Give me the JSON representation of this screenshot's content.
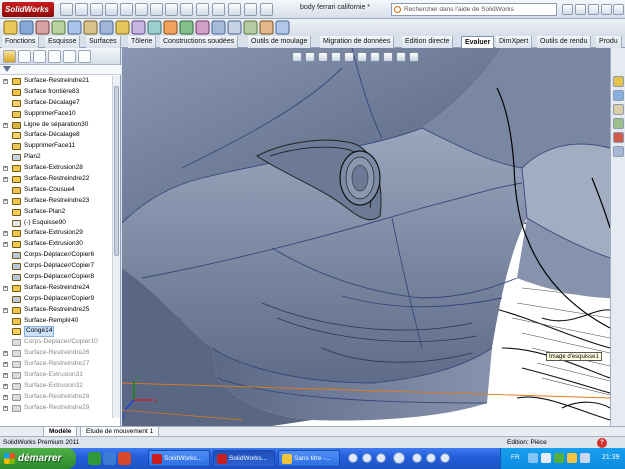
{
  "app": {
    "logo_text": "SolidWorks",
    "document_title": "body ferrari californie *",
    "search_placeholder": "Rechercher dans l'aide de SolidWorks"
  },
  "ribbon_tabs": [
    {
      "label": "Fonctions"
    },
    {
      "label": "Esquisse"
    },
    {
      "label": "Surfaces"
    },
    {
      "label": "Tôlerie"
    },
    {
      "label": "Constructions soudées"
    },
    {
      "label": "Outils de moulage"
    },
    {
      "label": "Migration de données"
    },
    {
      "label": "Edition directe"
    },
    {
      "label": "Evaluer"
    },
    {
      "label": "DimXpert"
    },
    {
      "label": "Outils de rendu"
    },
    {
      "label": "Produ"
    }
  ],
  "active_tab": "Evaluer",
  "feature_tree": [
    {
      "label": "Surface-Restreindre21",
      "icon": "surface-trim-icon",
      "expand": true,
      "state": "normal"
    },
    {
      "label": "Surface frontière83",
      "icon": "boundary-surface-icon",
      "expand": false,
      "state": "normal"
    },
    {
      "label": "Surface-Décalage7",
      "icon": "offset-surface-icon",
      "expand": false,
      "state": "normal"
    },
    {
      "label": "SupprimerFace10",
      "icon": "delete-face-icon",
      "expand": false,
      "state": "normal"
    },
    {
      "label": "Ligne de séparation30",
      "icon": "split-line-icon",
      "expand": true,
      "state": "normal"
    },
    {
      "label": "Surface-Décalage8",
      "icon": "offset-surface-icon",
      "expand": false,
      "state": "normal"
    },
    {
      "label": "SupprimerFace11",
      "icon": "delete-face-icon",
      "expand": false,
      "state": "normal"
    },
    {
      "label": "Plan2",
      "icon": "plane-icon",
      "expand": false,
      "state": "normal"
    },
    {
      "label": "Surface-Extrusion28",
      "icon": "extrude-surface-icon",
      "expand": true,
      "state": "normal"
    },
    {
      "label": "Surface-Restreindre22",
      "icon": "surface-trim-icon",
      "expand": true,
      "state": "normal"
    },
    {
      "label": "Surface-Cousue4",
      "icon": "knit-surface-icon",
      "expand": false,
      "state": "normal"
    },
    {
      "label": "Surface-Restreindre23",
      "icon": "surface-trim-icon",
      "expand": true,
      "state": "normal"
    },
    {
      "label": "Surface-Plan2",
      "icon": "planar-surface-icon",
      "expand": false,
      "state": "normal"
    },
    {
      "label": "(-) Esquisse90",
      "icon": "sketch-icon",
      "expand": false,
      "state": "normal"
    },
    {
      "label": "Surface-Extrusion29",
      "icon": "extrude-surface-icon",
      "expand": true,
      "state": "normal"
    },
    {
      "label": "Surface-Extrusion30",
      "icon": "extrude-surface-icon",
      "expand": true,
      "state": "normal"
    },
    {
      "label": "Corps-Déplacer/Copier6",
      "icon": "move-copy-body-icon",
      "expand": false,
      "state": "normal"
    },
    {
      "label": "Corps-Déplacer/Copier7",
      "icon": "move-copy-body-icon",
      "expand": false,
      "state": "normal"
    },
    {
      "label": "Corps-Déplacer/Copier8",
      "icon": "move-copy-body-icon",
      "expand": false,
      "state": "normal"
    },
    {
      "label": "Surface-Restreindre24",
      "icon": "surface-trim-icon",
      "expand": true,
      "state": "normal"
    },
    {
      "label": "Corps-Déplacer/Copier9",
      "icon": "move-copy-body-icon",
      "expand": false,
      "state": "normal"
    },
    {
      "label": "Surface-Restreindre25",
      "icon": "surface-trim-icon",
      "expand": true,
      "state": "normal"
    },
    {
      "label": "Surface-Remplir40",
      "icon": "fill-surface-icon",
      "expand": false,
      "state": "normal"
    },
    {
      "label": "Congé14",
      "icon": "fillet-icon",
      "expand": false,
      "state": "selected"
    },
    {
      "label": "Corps-Déplacer/Copier10",
      "icon": "move-copy-body-icon",
      "expand": false,
      "state": "suppressed"
    },
    {
      "label": "Surface-Restreindre26",
      "icon": "surface-trim-icon",
      "expand": true,
      "state": "suppressed"
    },
    {
      "label": "Surface-Restreindre27",
      "icon": "surface-trim-icon",
      "expand": true,
      "state": "suppressed"
    },
    {
      "label": "Surface-Extrusion31",
      "icon": "extrude-surface-icon",
      "expand": true,
      "state": "suppressed"
    },
    {
      "label": "Surface-Extrusion32",
      "icon": "extrude-surface-icon",
      "expand": true,
      "state": "suppressed"
    },
    {
      "label": "Surface-Restreindre28",
      "icon": "surface-trim-icon",
      "expand": true,
      "state": "suppressed"
    },
    {
      "label": "Surface-Restreindre29",
      "icon": "surface-trim-icon",
      "expand": true,
      "state": "suppressed"
    }
  ],
  "viewport": {
    "tooltip": "Image d'esquisse1",
    "axis_x": "X",
    "axis_y": "Y",
    "axis_z": "Z"
  },
  "document_tabs": [
    {
      "label": "Modèle",
      "active": true
    },
    {
      "label": "Etude de mouvement 1",
      "active": false
    }
  ],
  "status": {
    "left": "SolidWorks Premium 2011",
    "mode": "Edition: Pièce",
    "help": "?"
  },
  "taskbar": {
    "start_label": "démarrer",
    "tasks": [
      {
        "label": "SolidWorks..."
      },
      {
        "label": "SolidWorks..."
      },
      {
        "label": "Sans titre -..."
      }
    ],
    "tray_lang": "FR",
    "clock": "21:39"
  },
  "colors": {
    "surface": "#6f7d98",
    "surface_light": "#a3aec3",
    "surface_dark": "#4d5a74",
    "selected": "#cfe2fb"
  }
}
